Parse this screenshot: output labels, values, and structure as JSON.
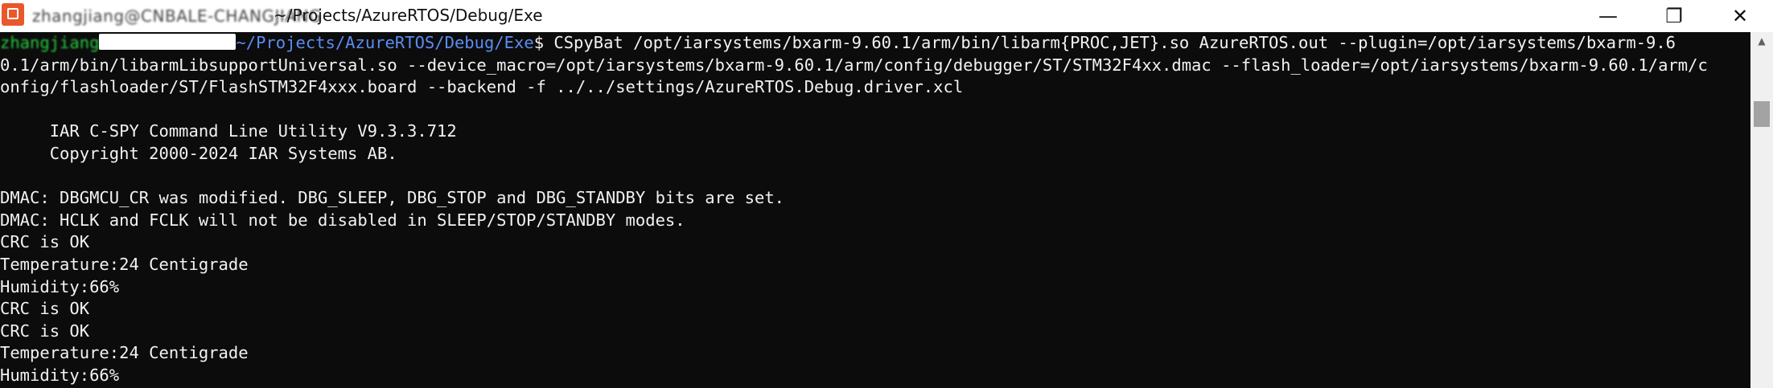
{
  "window": {
    "title_user": "zhangjiang@CNBALE-CHANGJIANG",
    "title_path": "~/Projects/AzureRTOS/Debug/Exe",
    "minimize_glyph": "—",
    "maximize_glyph": "❐",
    "close_glyph": "✕"
  },
  "terminal": {
    "prompt_user": "zhangjiang",
    "prompt_path": "~/Projects/AzureRTOS/Debug/Exe",
    "prompt_symbol": "$",
    "command_line1": " CSpyBat /opt/iarsystems/bxarm-9.60.1/arm/bin/libarm{PROC,JET}.so AzureRTOS.out --plugin=/opt/iarsystems/bxarm-9.6",
    "command_line2": "0.1/arm/bin/libarmLibsupportUniversal.so --device_macro=/opt/iarsystems/bxarm-9.60.1/arm/config/debugger/ST/STM32F4xx.dmac --flash_loader=/opt/iarsystems/bxarm-9.60.1/arm/c",
    "command_line3": "onfig/flashloader/ST/FlashSTM32F4xxx.board --backend -f ../../settings/AzureRTOS.Debug.driver.xcl",
    "output": [
      "",
      "     IAR C-SPY Command Line Utility V9.3.3.712",
      "     Copyright 2000-2024 IAR Systems AB.",
      "",
      "DMAC: DBGMCU_CR was modified. DBG_SLEEP, DBG_STOP and DBG_STANDBY bits are set.",
      "DMAC: HCLK and FCLK will not be disabled in SLEEP/STOP/STANDBY modes.",
      "CRC is OK",
      "Temperature:24 Centigrade",
      "Humidity:66%",
      "CRC is OK",
      "CRC is OK",
      "Temperature:24 Centigrade",
      "Humidity:66%"
    ]
  },
  "scrollbar": {
    "up_glyph": "▲"
  }
}
